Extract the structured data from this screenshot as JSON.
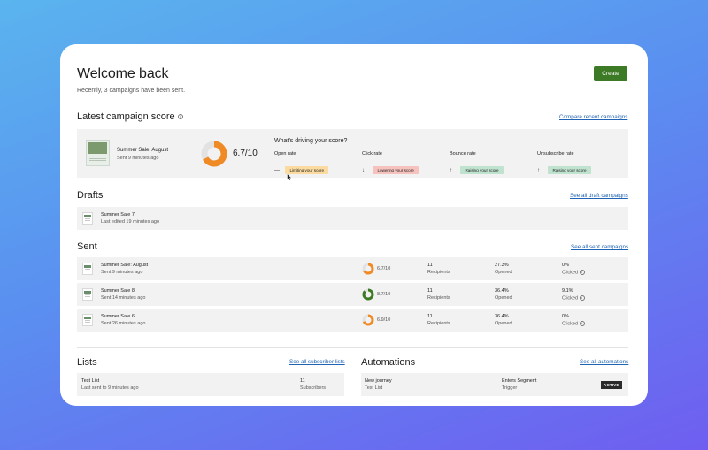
{
  "colors": {
    "accent_green": "#3d7a25",
    "link_blue": "#1f63b5",
    "score_orange": "#f08a24",
    "score_green": "#3d7a25"
  },
  "header": {
    "title": "Welcome back",
    "subtitle": "Recently, 3 campaigns have been sent.",
    "create_label": "Create"
  },
  "score": {
    "title": "Latest campaign score",
    "link": "Compare recent campaigns",
    "campaign_name": "Summer Sale: August",
    "campaign_time": "Sent 9 minutes ago",
    "value_text": "6.7/10",
    "value": 6.7,
    "drivers_title": "What’s driving your score?",
    "drivers": [
      {
        "label": "Open rate",
        "icon": "dash-icon",
        "arrow": "—",
        "pill": "Limiting your score",
        "pill_color": "#fbdba0"
      },
      {
        "label": "Click rate",
        "icon": "arrow-down-icon",
        "arrow": "↓",
        "pill": "Lowering your score",
        "pill_color": "#f6c2bd"
      },
      {
        "label": "Bounce rate",
        "icon": "arrow-up-icon",
        "arrow": "↑",
        "pill": "Raising your score",
        "pill_color": "#bfe3cf"
      },
      {
        "label": "Unsubscribe rate",
        "icon": "arrow-up-icon",
        "arrow": "↑",
        "pill": "Raising your score",
        "pill_color": "#bfe3cf"
      }
    ]
  },
  "drafts": {
    "title": "Drafts",
    "link": "See all draft campaigns",
    "items": [
      {
        "name": "Summer Sale 7",
        "time": "Last edited 19 minutes ago"
      }
    ]
  },
  "sent": {
    "title": "Sent",
    "link": "See all sent campaigns",
    "items": [
      {
        "name": "Summer Sale: August",
        "time": "Sent 9 minutes ago",
        "score_text": "6.7/10",
        "score": 6.7,
        "ring_color": "#f08a24",
        "recipients": "11",
        "recipients_label": "Recipients",
        "opened": "27.3%",
        "opened_label": "Opened",
        "clicked": "0%",
        "clicked_label": "Clicked"
      },
      {
        "name": "Summer Sale 8",
        "time": "Sent 14 minutes ago",
        "score_text": "8.7/10",
        "score": 8.7,
        "ring_color": "#3d7a25",
        "recipients": "11",
        "recipients_label": "Recipients",
        "opened": "36.4%",
        "opened_label": "Opened",
        "clicked": "9.1%",
        "clicked_label": "Clicked"
      },
      {
        "name": "Summer Sale 6",
        "time": "Sent 26 minutes ago",
        "score_text": "6.9/10",
        "score": 6.9,
        "ring_color": "#f08a24",
        "recipients": "11",
        "recipients_label": "Recipients",
        "opened": "36.4%",
        "opened_label": "Opened",
        "clicked": "0%",
        "clicked_label": "Clicked"
      }
    ]
  },
  "lists": {
    "title": "Lists",
    "link": "See all subscriber lists",
    "items": [
      {
        "name": "Test List",
        "time": "Last sent to 9 minutes ago",
        "count": "11",
        "count_label": "Subscribers"
      }
    ]
  },
  "automations": {
    "title": "Automations",
    "link": "See all automations",
    "items": [
      {
        "name": "New journey",
        "list": "Test List",
        "trigger": "Enters Segment",
        "trigger_label": "Trigger",
        "status": "ACTIVE"
      }
    ]
  }
}
